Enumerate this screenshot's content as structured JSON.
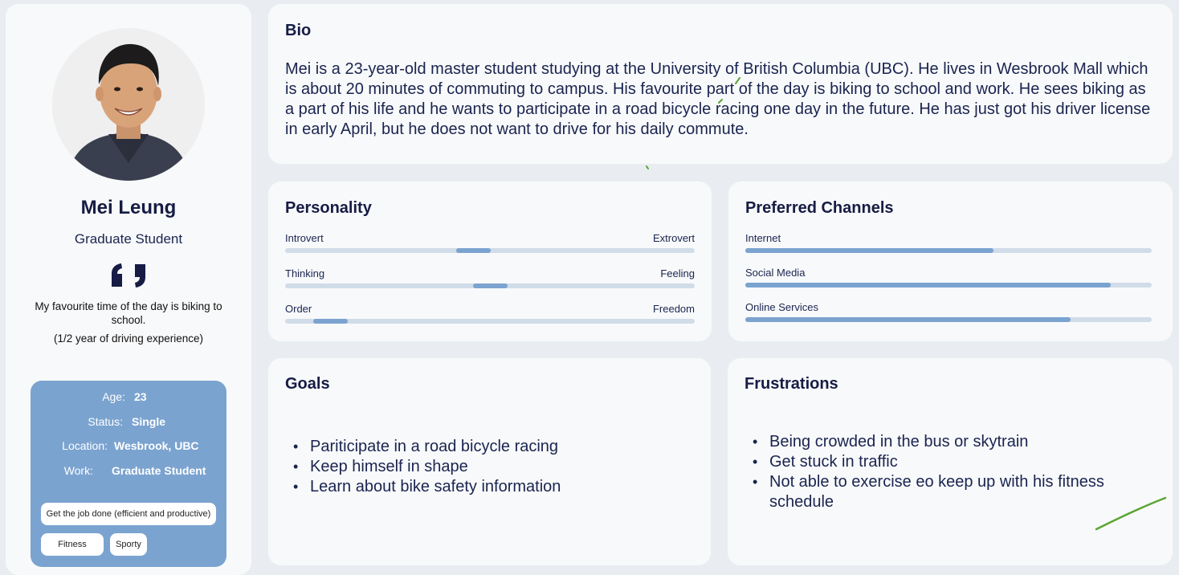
{
  "persona": {
    "name": "Mei Leung",
    "role": "Graduate Student",
    "quote": "My favourite time of the day is biking to school.",
    "quote_note": "(1/2 year of driving experience)"
  },
  "info": {
    "age_label": "Age:",
    "age": "23",
    "status_label": "Status:",
    "status": "Single",
    "location_label": "Location:",
    "location": "Wesbrook, UBC",
    "work_label": "Work:",
    "work": "Graduate Student"
  },
  "tags": [
    "Get the job done (efficient and productive)",
    "Fitness",
    "Sporty"
  ],
  "bio": {
    "title": "Bio",
    "text": "Mei is a 23-year-old master student studying at the University of British Columbia (UBC). He lives in Wesbrook Mall which is about 20 minutes of commuting to campus. His favourite part of the day is biking to school and work. He sees biking as a part of his life and he wants to participate in a road bicycle racing one day in the future. He has just got his driver license in early April, but he does not want to drive for his daily commute."
  },
  "personality": {
    "title": "Personality",
    "sliders": [
      {
        "left": "Introvert",
        "right": "Extrovert",
        "value": 0.46
      },
      {
        "left": "Thinking",
        "right": "Feeling",
        "value": 0.5
      },
      {
        "left": "Order",
        "right": "Freedom",
        "value": 0.11
      }
    ]
  },
  "channels": {
    "title": "Preferred Channels",
    "items": [
      {
        "label": "Internet",
        "value": 0.61
      },
      {
        "label": "Social Media",
        "value": 0.9
      },
      {
        "label": "Online Services",
        "value": 0.8
      }
    ]
  },
  "goals": {
    "title": "Goals",
    "items": [
      "Pariticipate in a road bicycle racing",
      "Keep himself in shape",
      "Learn about bike safety information"
    ]
  },
  "frustrations": {
    "title": "Frustrations",
    "items": [
      "Being crowded in the bus or skytrain",
      "Get stuck in traffic",
      "Not able to exercise eo keep up with his fitness schedule"
    ]
  },
  "colors": {
    "accent": "#7ba3d0",
    "track": "#d1dce9",
    "text": "#1a2450",
    "annotation": "#5aa531"
  }
}
